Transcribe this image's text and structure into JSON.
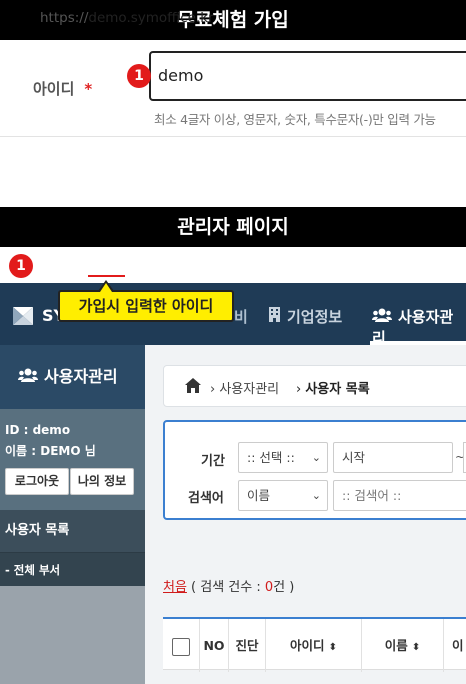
{
  "signup": {
    "section_title": "무료체험 가입",
    "id_label": "아이디",
    "required_mark": "*",
    "id_value": "demo",
    "hint": "최소 4글자 이상, 영문자, 숫자, 특수문자(-)만 입력 가능",
    "badge": "1"
  },
  "admin": {
    "section_title": "관리자 페이지",
    "badge": "1",
    "url_prefix": "https://",
    "url_host": "demo.symoffice.kr",
    "callout": "가입시 입력한 아이디",
    "nav": {
      "brand": "SY",
      "partial_item": "비",
      "company": "기업정보",
      "users": "사용자관리"
    },
    "sidebar": {
      "title": "사용자관리",
      "user_id": "ID : demo",
      "user_name": "이름 : DEMO 님",
      "logout": "로그아웃",
      "my_info": "나의 정보",
      "menu_users": "사용자 목록",
      "menu_all": "- 전체 부서"
    },
    "breadcrumb": {
      "level1": "사용자관리",
      "level2": "사용자 목록"
    },
    "search": {
      "period_label": "기간",
      "period_select": ":: 선택 ::",
      "start_placeholder": "시작",
      "tilde": "~",
      "field_label": "검색어",
      "field_select": "이름",
      "keyword_placeholder": ":: 검색어 ::"
    },
    "result": {
      "first": "처음",
      "open": " ( 검색 건수 : ",
      "count": "0",
      "close": "건 )"
    },
    "table": {
      "no": "NO",
      "diag": "진단",
      "id": "아이디",
      "name": "이름",
      "more": "이"
    }
  }
}
